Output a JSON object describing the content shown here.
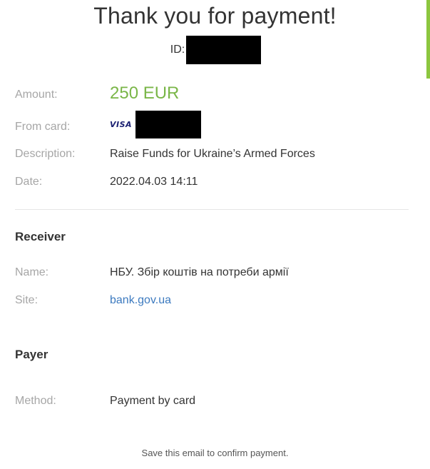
{
  "header": {
    "title": "Thank you for payment!",
    "id_label": "ID:"
  },
  "payment": {
    "amount_label": "Amount:",
    "amount_value": "250 EUR",
    "card_label": "From card:",
    "card_brand": "VISA",
    "description_label": "Description:",
    "description_value": "Raise Funds for Ukraine’s Armed Forces",
    "date_label": "Date:",
    "date_value": "2022.04.03 14:11"
  },
  "receiver": {
    "title": "Receiver",
    "name_label": "Name:",
    "name_value": "НБУ. Збір коштів на потреби армії",
    "site_label": "Site:",
    "site_value": "bank.gov.ua"
  },
  "payer": {
    "title": "Payer",
    "method_label": "Method:",
    "method_value": "Payment by card"
  },
  "footer": {
    "note": "Save this email to confirm payment."
  },
  "colors": {
    "accent_green": "#7ab648",
    "link_blue": "#3c7abf",
    "label_gray": "#a6a6a6",
    "scrollbar_green": "#8cc63f"
  }
}
